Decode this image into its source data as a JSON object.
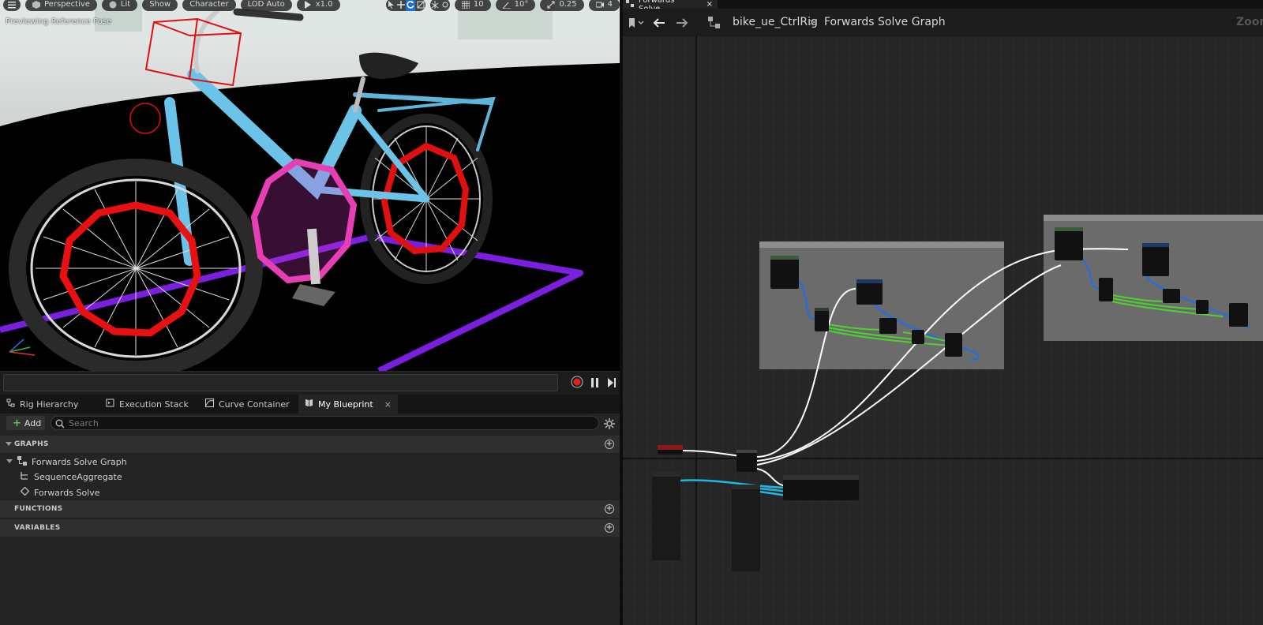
{
  "viewport": {
    "toolbar": {
      "perspective": "Perspective",
      "lit": "Lit",
      "show": "Show",
      "character": "Character",
      "lod": "LOD Auto",
      "speed": "x1.0",
      "grid_snap": "10",
      "angle_snap": "10°",
      "scale_snap": "0.25",
      "camera_speed": "4"
    },
    "caption": "Previewing Reference Pose"
  },
  "panel_tabs": [
    {
      "label": "Rig Hierarchy",
      "icon": "hierarchy-icon"
    },
    {
      "label": "Execution Stack",
      "icon": "execution-stack-icon"
    },
    {
      "label": "Curve Container",
      "icon": "curve-icon"
    },
    {
      "label": "My Blueprint",
      "icon": "blueprint-book-icon",
      "close": "×"
    }
  ],
  "my_blueprint": {
    "add_label": "Add",
    "search_placeholder": "Search",
    "sections": {
      "graphs": "GRAPHS",
      "functions": "FUNCTIONS",
      "variables": "VARIABLES"
    },
    "graph_items": [
      "Forwards Solve Graph",
      "SequenceAggregate",
      "Forwards Solve"
    ]
  },
  "graph_editor": {
    "tab_title": "Forwards Solve...",
    "tab_close": "×",
    "breadcrumb": [
      "bike_ue_CtrlRig",
      "Forwards Solve Graph"
    ],
    "breadcrumb_separator": ">",
    "zoom_label": "Zoom"
  },
  "colors": {
    "accent": "#1f6fd1",
    "exec_wire": "#ffffff",
    "transform_wire": "#2a6dd6",
    "float_wire": "#4fd030",
    "vector_wire": "#1fb8e0",
    "comment_box": "#6b6b6b"
  }
}
